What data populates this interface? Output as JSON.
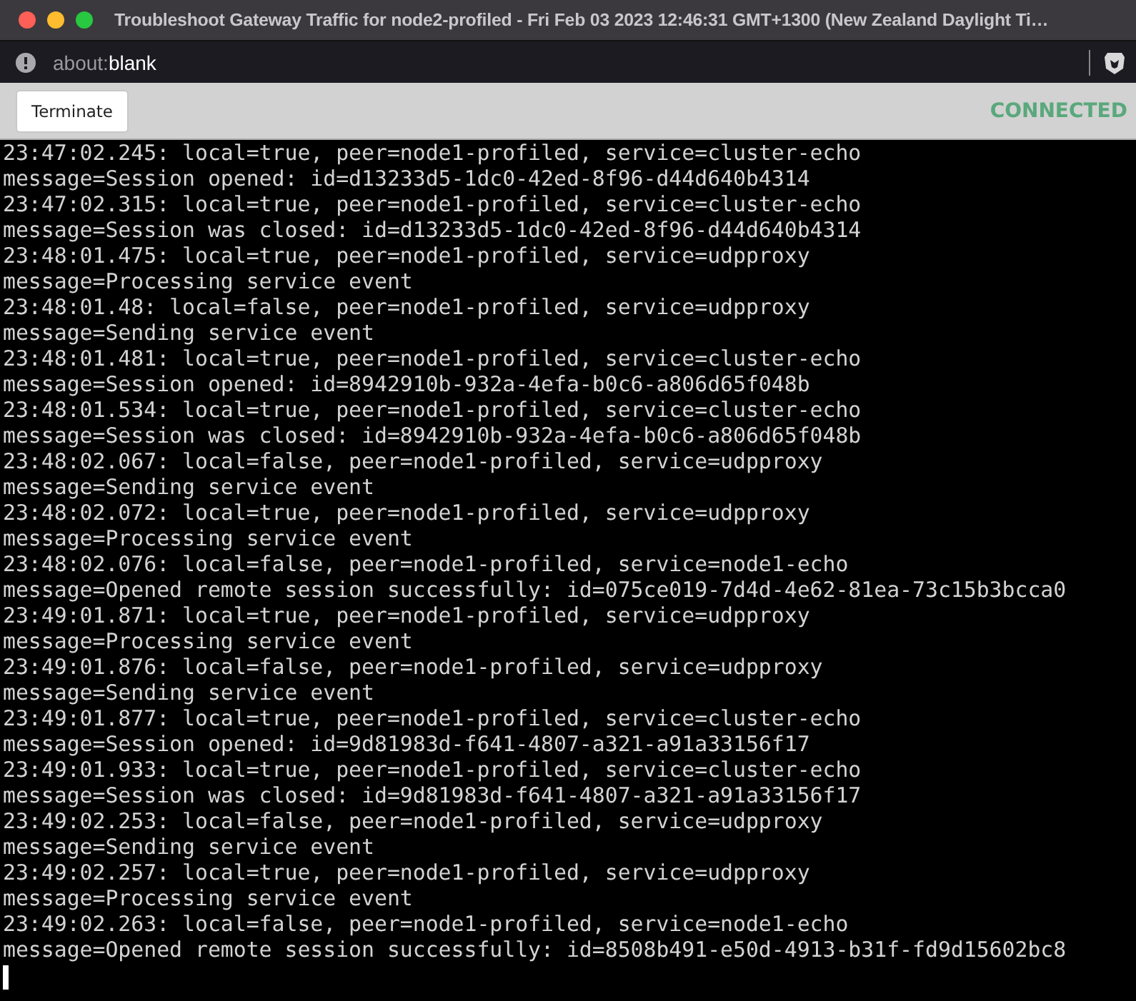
{
  "window": {
    "title": "Troubleshoot Gateway Traffic for node2-profiled - Fri Feb 03 2023 12:46:31 GMT+1300 (New Zealand Daylight Ti…"
  },
  "address_bar": {
    "scheme": "about:",
    "path": "blank"
  },
  "toolbar": {
    "button": "Terminate",
    "status": "CONNECTED"
  },
  "terminal": {
    "lines": [
      "23:47:02.245: local=true, peer=node1-profiled, service=cluster-echo",
      "message=Session opened: id=d13233d5-1dc0-42ed-8f96-d44d640b4314",
      "23:47:02.315: local=true, peer=node1-profiled, service=cluster-echo",
      "message=Session was closed: id=d13233d5-1dc0-42ed-8f96-d44d640b4314",
      "23:48:01.475: local=true, peer=node1-profiled, service=udpproxy",
      "message=Processing service event",
      "23:48:01.48: local=false, peer=node1-profiled, service=udpproxy",
      "message=Sending service event",
      "23:48:01.481: local=true, peer=node1-profiled, service=cluster-echo",
      "message=Session opened: id=8942910b-932a-4efa-b0c6-a806d65f048b",
      "23:48:01.534: local=true, peer=node1-profiled, service=cluster-echo",
      "message=Session was closed: id=8942910b-932a-4efa-b0c6-a806d65f048b",
      "23:48:02.067: local=false, peer=node1-profiled, service=udpproxy",
      "message=Sending service event",
      "23:48:02.072: local=true, peer=node1-profiled, service=udpproxy",
      "message=Processing service event",
      "23:48:02.076: local=false, peer=node1-profiled, service=node1-echo",
      "message=Opened remote session successfully: id=075ce019-7d4d-4e62-81ea-73c15b3bcca0",
      "23:49:01.871: local=true, peer=node1-profiled, service=udpproxy",
      "message=Processing service event",
      "23:49:01.876: local=false, peer=node1-profiled, service=udpproxy",
      "message=Sending service event",
      "23:49:01.877: local=true, peer=node1-profiled, service=cluster-echo",
      "message=Session opened: id=9d81983d-f641-4807-a321-a91a33156f17",
      "23:49:01.933: local=true, peer=node1-profiled, service=cluster-echo",
      "message=Session was closed: id=9d81983d-f641-4807-a321-a91a33156f17",
      "23:49:02.253: local=false, peer=node1-profiled, service=udpproxy",
      "message=Sending service event",
      "23:49:02.257: local=true, peer=node1-profiled, service=udpproxy",
      "message=Processing service event",
      "23:49:02.263: local=false, peer=node1-profiled, service=node1-echo",
      "message=Opened remote session successfully: id=8508b491-e50d-4913-b31f-fd9d15602bc8"
    ]
  }
}
